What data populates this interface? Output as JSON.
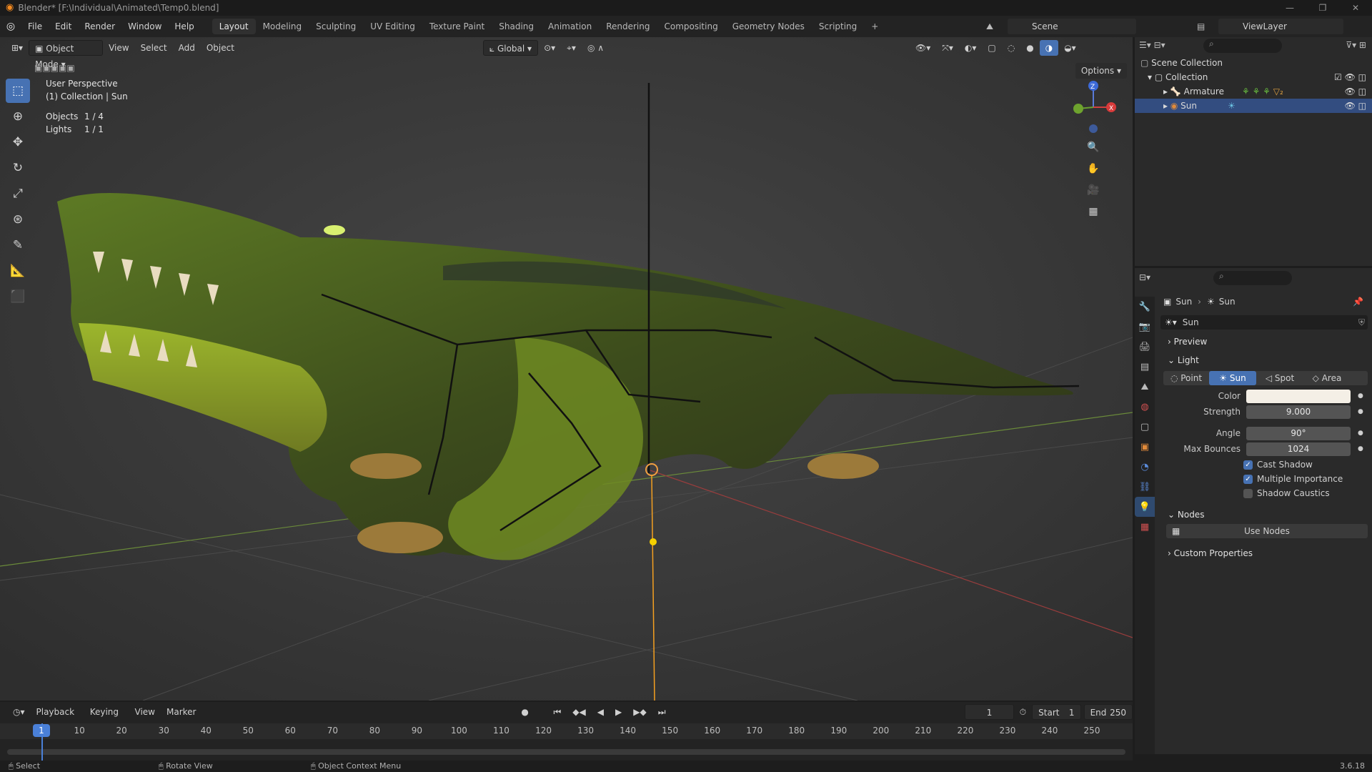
{
  "window": {
    "title": "Blender* [F:\\Individual\\Animated\\Temp0.blend]"
  },
  "menus": [
    "File",
    "Edit",
    "Render",
    "Window",
    "Help"
  ],
  "workspaces": [
    "Layout",
    "Modeling",
    "Sculpting",
    "UV Editing",
    "Texture Paint",
    "Shading",
    "Animation",
    "Rendering",
    "Compositing",
    "Geometry Nodes",
    "Scripting"
  ],
  "active_workspace": "Layout",
  "scene": "Scene",
  "view_layer": "ViewLayer",
  "viewport": {
    "mode": "Object Mode",
    "header_menus": [
      "View",
      "Select",
      "Add",
      "Object"
    ],
    "orientation": "Global",
    "options_label": "Options",
    "overlay_title": "User Perspective",
    "overlay_subtitle": "(1) Collection | Sun",
    "stats": [
      {
        "label": "Objects",
        "value": "1 / 4"
      },
      {
        "label": "Lights",
        "value": "1 / 1"
      }
    ],
    "gizmo_axes": {
      "x": "X",
      "y": "Y",
      "z": "Z"
    }
  },
  "outliner": {
    "root": "Scene Collection",
    "collection": "Collection",
    "items": [
      {
        "name": "Armature",
        "selected": false
      },
      {
        "name": "Sun",
        "selected": true
      }
    ]
  },
  "properties": {
    "breadcrumb": [
      "Sun",
      "Sun"
    ],
    "datablock": "Sun",
    "panels": {
      "preview": "Preview",
      "light": "Light",
      "nodes": "Nodes",
      "custom": "Custom Properties"
    },
    "light_types": [
      "Point",
      "Sun",
      "Spot",
      "Area"
    ],
    "active_light_type": "Sun",
    "color_label": "Color",
    "color_value": "#f4efe6",
    "strength_label": "Strength",
    "strength": "9.000",
    "angle_label": "Angle",
    "angle": "90°",
    "max_bounces_label": "Max Bounces",
    "max_bounces": "1024",
    "checks": [
      {
        "label": "Cast Shadow",
        "on": true
      },
      {
        "label": "Multiple Importance",
        "on": true
      },
      {
        "label": "Shadow Caustics",
        "on": false
      }
    ],
    "use_nodes": "Use Nodes"
  },
  "timeline": {
    "menus": [
      "Playback",
      "Keying",
      "View",
      "Marker"
    ],
    "current_frame": "1",
    "start_label": "Start",
    "start": "1",
    "end_label": "End",
    "end": "250",
    "ticks": [
      "1",
      "10",
      "20",
      "30",
      "40",
      "50",
      "60",
      "70",
      "80",
      "90",
      "100",
      "110",
      "120",
      "130",
      "140",
      "150",
      "160",
      "170",
      "180",
      "190",
      "200",
      "210",
      "220",
      "230",
      "240",
      "250"
    ]
  },
  "statusbar": {
    "select": "Select",
    "rotate": "Rotate View",
    "context": "Object Context Menu",
    "version": "3.6.18"
  }
}
